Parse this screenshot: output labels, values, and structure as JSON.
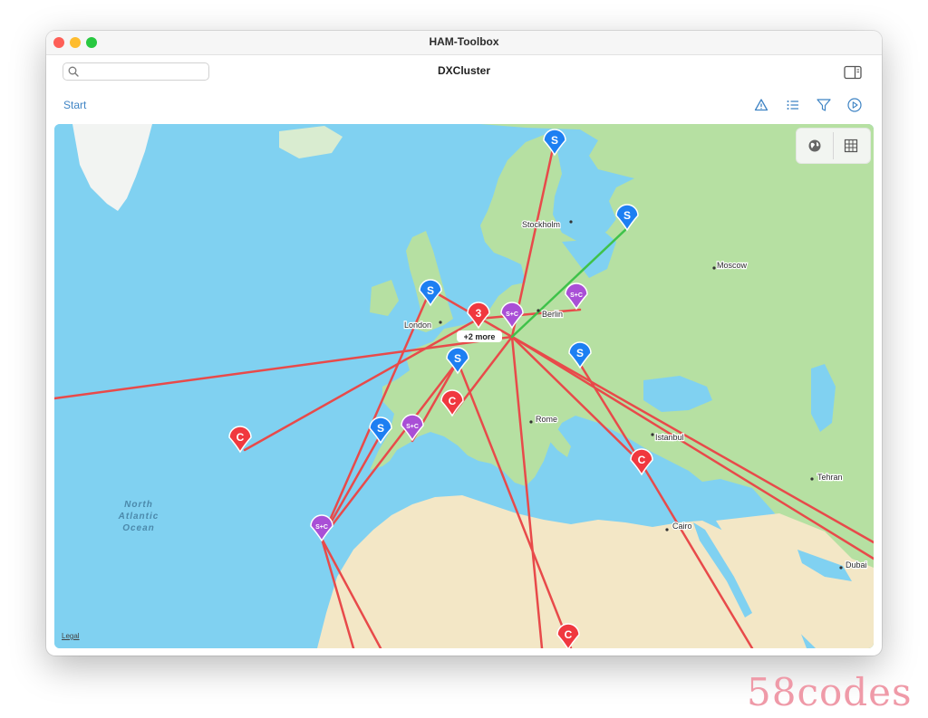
{
  "window": {
    "title": "HAM-Toolbox"
  },
  "toolbar": {
    "page_title": "DXCluster",
    "search_placeholder": "",
    "breadcrumb": "Start",
    "tools": [
      "warning-icon",
      "list-icon",
      "filter-icon",
      "play-icon"
    ],
    "sidebar_toggle_icon": "sidebar-icon"
  },
  "map": {
    "controls": [
      "globe-icon",
      "grid-icon"
    ],
    "legal": "Legal",
    "ocean_label": [
      "North",
      "Atlantic",
      "Ocean"
    ],
    "cities": [
      "Stockholm",
      "Moscow",
      "London",
      "Berlin",
      "Rome",
      "Istanbul",
      "Tehran",
      "Cairo",
      "Dubai"
    ],
    "cluster_label": "+2 more",
    "pins": [
      {
        "label": "S",
        "type": "spotter"
      },
      {
        "label": "S",
        "type": "spotter"
      },
      {
        "label": "S",
        "type": "spotter"
      },
      {
        "label": "S",
        "type": "spotter"
      },
      {
        "label": "S",
        "type": "spotter"
      },
      {
        "label": "S",
        "type": "spotter"
      },
      {
        "label": "S+C",
        "type": "both"
      },
      {
        "label": "S+C",
        "type": "both"
      },
      {
        "label": "S+C",
        "type": "both"
      },
      {
        "label": "S+C",
        "type": "both"
      },
      {
        "label": "3",
        "type": "cluster"
      },
      {
        "label": "C",
        "type": "contact"
      },
      {
        "label": "C",
        "type": "contact"
      },
      {
        "label": "C",
        "type": "contact"
      },
      {
        "label": "C",
        "type": "contact"
      }
    ],
    "colors": {
      "water": "#80d1f1",
      "land": "#b6e0a2",
      "desert": "#f3e7c6",
      "path": "#e84a4a",
      "highlight_path": "#3fc24a",
      "spotter": "#1d7ff2",
      "contact": "#f0383f",
      "both": "#a94fd6",
      "cluster": "#f0383f"
    }
  },
  "watermark": "58codes"
}
